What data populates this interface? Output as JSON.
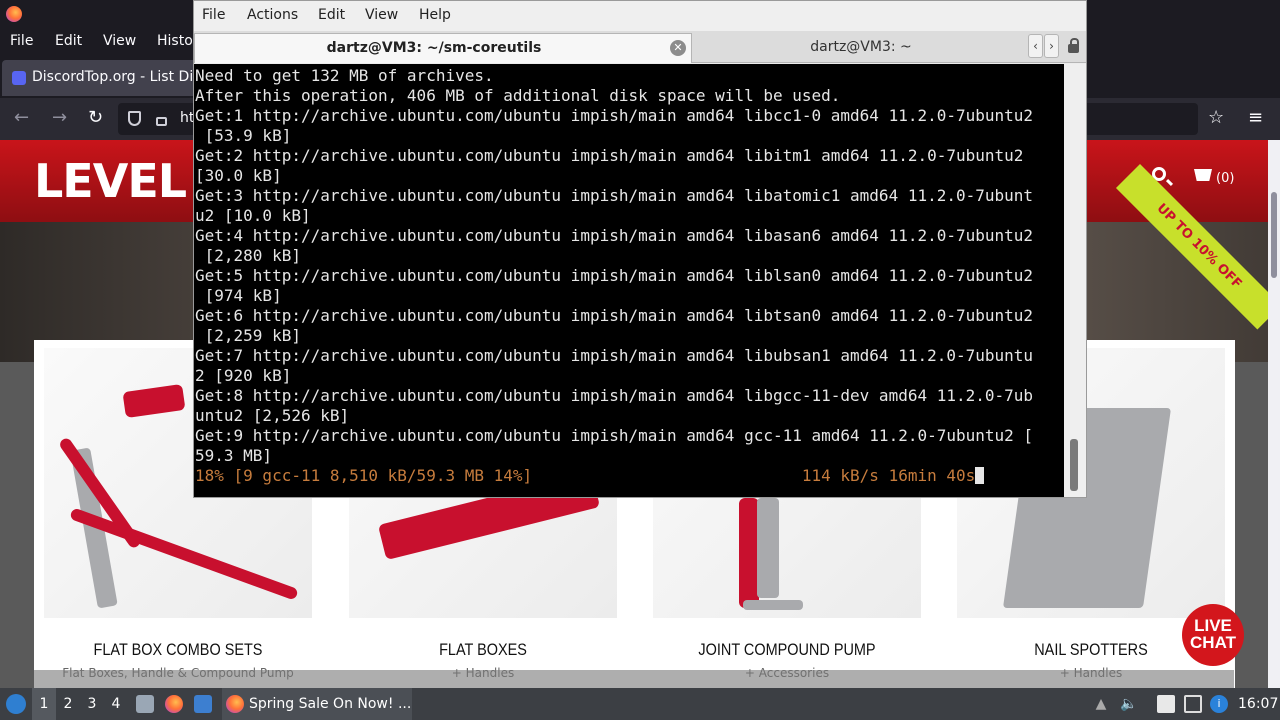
{
  "firefox": {
    "menu": [
      "File",
      "Edit",
      "View",
      "Histo"
    ],
    "tab_title": "DiscordTop.org - List Dis",
    "url_text": "ht"
  },
  "website": {
    "logo": "LEVEL",
    "cart_count": "(0)",
    "ribbon": "UP TO 10% OFF",
    "live_chat_line1": "LIVE",
    "live_chat_line2": "CHAT",
    "products": [
      {
        "name": "FLAT BOX COMBO SETS",
        "sub": "Flat Boxes, Handle & Compound Pump"
      },
      {
        "name": "FLAT BOXES",
        "sub": "+ Handles"
      },
      {
        "name": "JOINT COMPOUND PUMP",
        "sub": "+ Accessories"
      },
      {
        "name": "NAIL SPOTTERS",
        "sub": "+ Handles"
      }
    ]
  },
  "terminal": {
    "menu": [
      "File",
      "Actions",
      "Edit",
      "View",
      "Help"
    ],
    "tabs": [
      {
        "title": "dartz@VM3: ~/sm-coreutils",
        "active": true
      },
      {
        "title": "dartz@VM3: ~",
        "active": false
      }
    ],
    "lines": [
      "Need to get 132 MB of archives.",
      "After this operation, 406 MB of additional disk space will be used.",
      "Get:1 http://archive.ubuntu.com/ubuntu impish/main amd64 libcc1-0 amd64 11.2.0-7ubuntu2",
      " [53.9 kB]",
      "Get:2 http://archive.ubuntu.com/ubuntu impish/main amd64 libitm1 amd64 11.2.0-7ubuntu2",
      "[30.0 kB]",
      "Get:3 http://archive.ubuntu.com/ubuntu impish/main amd64 libatomic1 amd64 11.2.0-7ubunt",
      "u2 [10.0 kB]",
      "Get:4 http://archive.ubuntu.com/ubuntu impish/main amd64 libasan6 amd64 11.2.0-7ubuntu2",
      " [2,280 kB]",
      "Get:5 http://archive.ubuntu.com/ubuntu impish/main amd64 liblsan0 amd64 11.2.0-7ubuntu2",
      " [974 kB]",
      "Get:6 http://archive.ubuntu.com/ubuntu impish/main amd64 libtsan0 amd64 11.2.0-7ubuntu2",
      " [2,259 kB]",
      "Get:7 http://archive.ubuntu.com/ubuntu impish/main amd64 libubsan1 amd64 11.2.0-7ubuntu",
      "2 [920 kB]",
      "Get:8 http://archive.ubuntu.com/ubuntu impish/main amd64 libgcc-11-dev amd64 11.2.0-7ub",
      "untu2 [2,526 kB]",
      "Get:9 http://archive.ubuntu.com/ubuntu impish/main amd64 gcc-11 amd64 11.2.0-7ubuntu2 [",
      "59.3 MB]"
    ],
    "progress_line": "18% [9 gcc-11 8,510 kB/59.3 MB 14%]                            114 kB/s 16min 40s"
  },
  "taskbar": {
    "workspaces": [
      "1",
      "2",
      "3",
      "4"
    ],
    "active_task": "Spring Sale On Now! ...",
    "clock": "16:07"
  }
}
